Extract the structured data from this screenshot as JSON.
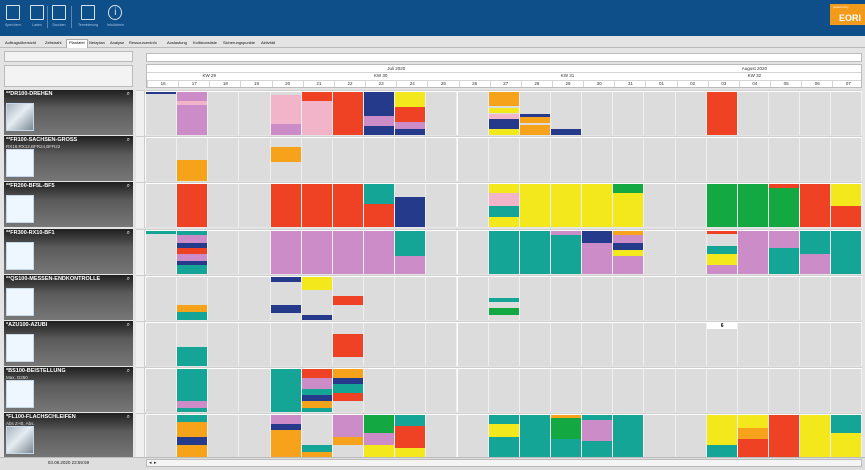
{
  "toolbar": {
    "buttons": [
      {
        "label": "Speichern",
        "icon": "save-icon"
      },
      {
        "label": "Laden",
        "icon": "folder-icon"
      },
      {
        "label": "Drucken",
        "icon": "print-icon"
      },
      {
        "label": "Terminierung",
        "icon": "calculator-icon"
      },
      {
        "label": "Info/Admin",
        "icon": "info-icon"
      }
    ],
    "logo_text": "EORI",
    "logo_small": "powered by"
  },
  "tabs": [
    "Auftragsübersicht",
    "Zeitstrahl",
    "Plantafel",
    "Netzplan",
    "Analyse",
    "Ressourceninfo",
    "Auslastung",
    "Kollisionsliste",
    "Sicherungspunkte",
    "Aktivität"
  ],
  "active_tab": "Plantafel",
  "header": {
    "months": [
      {
        "label": "Juli 2020",
        "from": 0,
        "to": 16
      },
      {
        "label": "August 2020",
        "from": 16,
        "to": 23
      }
    ],
    "weeks": [
      {
        "label": "KW 29",
        "from": 0,
        "to": 4
      },
      {
        "label": "KW 30",
        "from": 4,
        "to": 11
      },
      {
        "label": "KW 31",
        "from": 11,
        "to": 16
      },
      {
        "label": "KW 32",
        "from": 16,
        "to": 23
      }
    ],
    "days": [
      "16",
      "17",
      "18",
      "19",
      "20",
      "21",
      "22",
      "23",
      "24",
      "25",
      "26",
      "27",
      "28",
      "29",
      "30",
      "31",
      "01",
      "02",
      "03",
      "04",
      "05",
      "06",
      "07"
    ]
  },
  "colors": {
    "gray": "#dcdcdc",
    "red": "#ef4123",
    "pink": "#cc8cc8",
    "lightpink": "#f2b4c8",
    "navy": "#263a8c",
    "yellow": "#f2e81c",
    "orange": "#f6a21a",
    "teal": "#15a597",
    "green": "#13a842",
    "white": "#ffffff"
  },
  "resources": [
    {
      "name": "**DR100-DREHEN",
      "sub": "",
      "pic": "photo",
      "cells": {
        "0": [
          [
            "navy",
            0,
            0.05
          ],
          [
            "gray",
            0.05,
            1
          ]
        ],
        "1": [
          [
            "pink",
            0,
            0.22
          ],
          [
            "lightpink",
            0.22,
            0.3
          ],
          [
            "pink",
            0.3,
            1
          ]
        ],
        "4": [
          [
            "gray",
            0,
            0.08
          ],
          [
            "lightpink",
            0.08,
            0.65
          ],
          [
            "lightpink",
            0.65,
            0.75
          ],
          [
            "pink",
            0.75,
            1
          ]
        ],
        "5": [
          [
            "red",
            0,
            0.2
          ],
          [
            "lightpink",
            0.2,
            1
          ]
        ],
        "6": [
          [
            "red",
            0,
            1
          ]
        ],
        "7": [
          [
            "navy",
            0,
            0.55
          ],
          [
            "pink",
            0.55,
            0.8
          ],
          [
            "navy",
            0.8,
            1
          ]
        ],
        "8": [
          [
            "yellow",
            0,
            0.35
          ],
          [
            "red",
            0.35,
            0.7
          ],
          [
            "pink",
            0.7,
            0.85
          ],
          [
            "navy",
            0.85,
            1
          ]
        ],
        "11": [
          [
            "orange",
            0,
            0.32
          ],
          [
            "gray",
            0.32,
            0.38
          ],
          [
            "yellow",
            0.38,
            0.5
          ],
          [
            "lightpink",
            0.5,
            0.62
          ],
          [
            "navy",
            0.62,
            0.85
          ],
          [
            "yellow",
            0.85,
            1
          ]
        ],
        "12": [
          [
            "gray",
            0,
            0.52
          ],
          [
            "navy",
            0.52,
            0.58
          ],
          [
            "orange",
            0.58,
            0.72
          ],
          [
            "gray",
            0.72,
            0.76
          ],
          [
            "orange",
            0.76,
            1
          ]
        ],
        "13": [
          [
            "gray",
            0,
            0.85
          ],
          [
            "navy",
            0.85,
            1
          ]
        ],
        "18": [
          [
            "red",
            0,
            1
          ]
        ]
      }
    },
    {
      "name": "**FR100-SACHSEN-GROSS",
      "sub": "RX18,RX12,BFR24,BFR22",
      "pic": "blank",
      "cells": {
        "1": [
          [
            "gray",
            0,
            0.5
          ],
          [
            "orange",
            0.5,
            1
          ]
        ],
        "4": [
          [
            "gray",
            0,
            0.2
          ],
          [
            "orange",
            0.2,
            0.55
          ],
          [
            "gray",
            0.55,
            1
          ]
        ]
      }
    },
    {
      "name": "**FR200-BF5L-BF5",
      "sub": "",
      "pic": "blank",
      "cells": {
        "1": [
          [
            "red",
            0,
            1
          ]
        ],
        "4": [
          [
            "red",
            0,
            1
          ]
        ],
        "5": [
          [
            "red",
            0,
            1
          ]
        ],
        "6": [
          [
            "red",
            0,
            1
          ]
        ],
        "7": [
          [
            "teal",
            0,
            0.45
          ],
          [
            "red",
            0.45,
            1
          ]
        ],
        "8": [
          [
            "gray",
            0,
            0.3
          ],
          [
            "navy",
            0.3,
            1
          ]
        ],
        "11": [
          [
            "yellow",
            0,
            0.2
          ],
          [
            "lightpink",
            0.2,
            0.5
          ],
          [
            "teal",
            0.5,
            0.75
          ],
          [
            "yellow",
            0.75,
            1
          ]
        ],
        "12": [
          [
            "yellow",
            0,
            1
          ]
        ],
        "13": [
          [
            "yellow",
            0,
            1
          ]
        ],
        "14": [
          [
            "yellow",
            0,
            1
          ]
        ],
        "15": [
          [
            "green",
            0,
            0.2
          ],
          [
            "yellow",
            0.2,
            1
          ]
        ],
        "18": [
          [
            "green",
            0,
            1
          ]
        ],
        "19": [
          [
            "green",
            0,
            1
          ]
        ],
        "20": [
          [
            "red",
            0,
            0.08
          ],
          [
            "green",
            0.08,
            1
          ]
        ],
        "21": [
          [
            "red",
            0,
            1
          ]
        ],
        "22": [
          [
            "yellow",
            0,
            0.5
          ],
          [
            "red",
            0.5,
            1
          ]
        ]
      }
    },
    {
      "name": "**FR300-RX10-BF1",
      "sub": "",
      "pic": "blank",
      "cells": {
        "0": [
          [
            "teal",
            0,
            0.08
          ],
          [
            "gray",
            0.08,
            1
          ]
        ],
        "1": [
          [
            "teal",
            0,
            0.1
          ],
          [
            "pink",
            0.1,
            0.3
          ],
          [
            "navy",
            0.3,
            0.4
          ],
          [
            "red",
            0.4,
            0.55
          ],
          [
            "pink",
            0.55,
            0.7
          ],
          [
            "navy",
            0.7,
            0.8
          ],
          [
            "teal",
            0.8,
            1
          ]
        ],
        "4": [
          [
            "pink",
            0,
            1
          ]
        ],
        "5": [
          [
            "pink",
            0,
            1
          ]
        ],
        "6": [
          [
            "pink",
            0,
            1
          ]
        ],
        "7": [
          [
            "pink",
            0,
            1
          ]
        ],
        "8": [
          [
            "teal",
            0,
            0.6
          ],
          [
            "pink",
            0.6,
            1
          ]
        ],
        "11": [
          [
            "teal",
            0,
            1
          ]
        ],
        "12": [
          [
            "teal",
            0,
            1
          ]
        ],
        "13": [
          [
            "pink",
            0,
            0.1
          ],
          [
            "teal",
            0.1,
            1
          ]
        ],
        "14": [
          [
            "navy",
            0,
            0.3
          ],
          [
            "pink",
            0.3,
            1
          ]
        ],
        "15": [
          [
            "orange",
            0,
            0.1
          ],
          [
            "pink",
            0.1,
            0.3
          ],
          [
            "navy",
            0.3,
            0.45
          ],
          [
            "yellow",
            0.45,
            0.6
          ],
          [
            "pink",
            0.6,
            1
          ]
        ],
        "18": [
          [
            "red",
            0,
            0.08
          ],
          [
            "gray",
            0.08,
            0.35
          ],
          [
            "teal",
            0.35,
            0.55
          ],
          [
            "yellow",
            0.55,
            0.8
          ],
          [
            "pink",
            0.8,
            1
          ]
        ],
        "19": [
          [
            "pink",
            0,
            1
          ]
        ],
        "20": [
          [
            "pink",
            0,
            0.4
          ],
          [
            "teal",
            0.4,
            1
          ]
        ],
        "21": [
          [
            "teal",
            0,
            0.55
          ],
          [
            "pink",
            0.55,
            1
          ]
        ],
        "22": [
          [
            "teal",
            0,
            1
          ]
        ]
      }
    },
    {
      "name": "**QS100-MESSEN-ENDKONTROLLE",
      "sub": "",
      "pic": "blank",
      "cells": {
        "1": [
          [
            "gray",
            0,
            0.65
          ],
          [
            "orange",
            0.65,
            0.82
          ],
          [
            "teal",
            0.82,
            1
          ]
        ],
        "4": [
          [
            "navy",
            0,
            0.12
          ],
          [
            "gray",
            0.12,
            0.65
          ],
          [
            "navy",
            0.65,
            0.85
          ],
          [
            "gray",
            0.85,
            1
          ]
        ],
        "5": [
          [
            "yellow",
            0,
            0.3
          ],
          [
            "gray",
            0.3,
            0.9
          ],
          [
            "navy",
            0.9,
            1
          ]
        ],
        "6": [
          [
            "gray",
            0,
            0.45
          ],
          [
            "red",
            0.45,
            0.65
          ],
          [
            "gray",
            0.65,
            1
          ]
        ],
        "11": [
          [
            "gray",
            0,
            0.5
          ],
          [
            "teal",
            0.5,
            0.58
          ],
          [
            "gray",
            0.58,
            0.72
          ],
          [
            "green",
            0.72,
            0.88
          ],
          [
            "gray",
            0.88,
            1
          ]
        ]
      }
    },
    {
      "name": "*AZU100-AZUBI",
      "sub": "",
      "pic": "blank",
      "cells": {
        "1": [
          [
            "gray",
            0,
            0.55
          ],
          [
            "teal",
            0.55,
            1
          ]
        ],
        "6": [
          [
            "gray",
            0,
            0.25
          ],
          [
            "red",
            0.25,
            0.8
          ],
          [
            "gray",
            0.8,
            1
          ]
        ],
        "18": [
          [
            "white",
            0,
            0.15
          ],
          [
            "gray",
            0.15,
            1
          ]
        ]
      },
      "mark": "6"
    },
    {
      "name": "*BS100-BEISTELLUNG",
      "sub": "Max. D250",
      "pic": "blank",
      "cells": {
        "1": [
          [
            "teal",
            0,
            0.75
          ],
          [
            "pink",
            0.75,
            0.9
          ],
          [
            "teal",
            0.9,
            1
          ]
        ],
        "4": [
          [
            "teal",
            0,
            1
          ]
        ],
        "5": [
          [
            "red",
            0,
            0.2
          ],
          [
            "pink",
            0.2,
            0.45
          ],
          [
            "teal",
            0.45,
            0.6
          ],
          [
            "navy",
            0.6,
            0.75
          ],
          [
            "orange",
            0.75,
            0.9
          ],
          [
            "teal",
            0.9,
            1
          ]
        ],
        "6": [
          [
            "orange",
            0,
            0.2
          ],
          [
            "navy",
            0.2,
            0.35
          ],
          [
            "teal",
            0.35,
            0.55
          ],
          [
            "red",
            0.55,
            0.75
          ],
          [
            "gray",
            0.75,
            1
          ]
        ]
      }
    },
    {
      "name": "*FL100-FLACHSCHLEIFEN",
      "sub": "Abs Z+B, Abs.",
      "pic": "photo",
      "cells": {
        "1": [
          [
            "teal",
            0,
            0.15
          ],
          [
            "orange",
            0.15,
            0.5
          ],
          [
            "navy",
            0.5,
            0.7
          ],
          [
            "orange",
            0.7,
            1
          ]
        ],
        "4": [
          [
            "pink",
            0,
            0.2
          ],
          [
            "navy",
            0.2,
            0.35
          ],
          [
            "orange",
            0.35,
            0.75
          ],
          [
            "orange",
            0.75,
            1
          ]
        ],
        "5": [
          [
            "gray",
            0,
            0.7
          ],
          [
            "teal",
            0.7,
            0.85
          ],
          [
            "orange",
            0.85,
            1
          ]
        ],
        "6": [
          [
            "pink",
            0,
            0.5
          ],
          [
            "orange",
            0.5,
            0.7
          ],
          [
            "gray",
            0.7,
            1
          ]
        ],
        "7": [
          [
            "green",
            0,
            0.4
          ],
          [
            "pink",
            0.4,
            0.7
          ],
          [
            "yellow",
            0.7,
            1
          ]
        ],
        "8": [
          [
            "teal",
            0,
            0.25
          ],
          [
            "red",
            0.25,
            0.75
          ],
          [
            "yellow",
            0.75,
            1
          ]
        ],
        "11": [
          [
            "teal",
            0,
            0.2
          ],
          [
            "yellow",
            0.2,
            0.5
          ],
          [
            "teal",
            0.5,
            1
          ]
        ],
        "12": [
          [
            "teal",
            0,
            1
          ]
        ],
        "13": [
          [
            "orange",
            0,
            0.05
          ],
          [
            "green",
            0.05,
            0.55
          ],
          [
            "teal",
            0.55,
            1
          ]
        ],
        "14": [
          [
            "teal",
            0,
            0.1
          ],
          [
            "pink",
            0.1,
            0.6
          ],
          [
            "teal",
            0.6,
            1
          ]
        ],
        "15": [
          [
            "teal",
            0,
            1
          ]
        ],
        "18": [
          [
            "yellow",
            0,
            0.7
          ],
          [
            "teal",
            0.7,
            1
          ]
        ],
        "19": [
          [
            "yellow",
            0,
            0.3
          ],
          [
            "orange",
            0.3,
            0.55
          ],
          [
            "red",
            0.55,
            1
          ]
        ],
        "20": [
          [
            "red",
            0,
            1
          ]
        ],
        "21": [
          [
            "yellow",
            0,
            1
          ]
        ],
        "22": [
          [
            "teal",
            0,
            0.4
          ],
          [
            "yellow",
            0.4,
            1
          ]
        ]
      }
    }
  ],
  "status": {
    "datetime": "03.08.2020 23:59:59"
  }
}
